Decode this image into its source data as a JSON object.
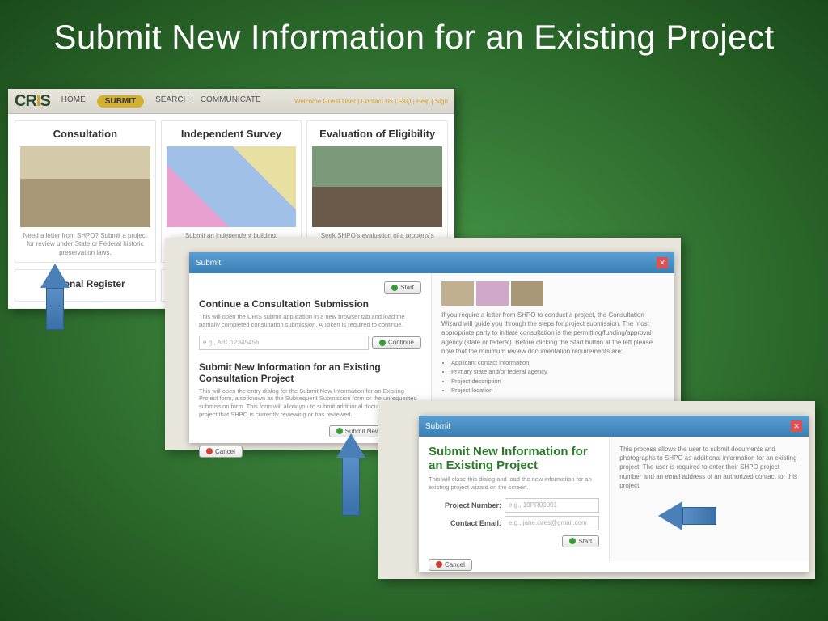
{
  "title": "Submit New Information for an Existing Project",
  "nav": {
    "logo": "CRIS",
    "items": [
      "HOME",
      "SUBMIT",
      "SEARCH",
      "COMMUNICATE"
    ],
    "welcome": "Welcome Guest User | Contact Us | FAQ | Help | Sign"
  },
  "cards": {
    "c1": {
      "title": "Consultation",
      "desc": "Need a letter from SHPO? Submit a project for review under State or Federal historic preservation laws."
    },
    "c2": {
      "title": "Independent Survey",
      "desc": "Submit an independent building,"
    },
    "c3": {
      "title": "Evaluation of Eligibility",
      "desc": "Seek SHPO's evaluation of a property's eligibility"
    },
    "c4": {
      "title": "National Register"
    }
  },
  "dialog1": {
    "bar": "Submit",
    "start": "Start",
    "sec1_title": "Continue a Consultation Submission",
    "sec1_desc": "This will open the CRIS submit application in a new browser tab and load the partially completed consultation submission. A Token is required to continue.",
    "sec1_placeholder": "e.g., ABC12345456",
    "sec1_btn": "Continue",
    "sec2_title": "Submit New Information for an Existing Consultation Project",
    "sec2_desc": "This will open the entry dialog for the Submit New Information for an Existing Project form, also known as the Subsequent Submission form or the unrequested submission form. This form will allow you to submit additional documentation for a project that SHPO is currently reviewing or has reviewed.",
    "sec2_btn": "Submit New Information",
    "cancel": "Cancel",
    "right_intro": "If you require a letter from SHPO to conduct a project, the Consultation Wizard will guide you through the steps for project submission. The most appropriate party to initiate consultation is the permitting/funding/approval agency (state or federal). Before clicking the Start button at the left please note that the minimum review documentation requirements are:",
    "right_bullets": [
      "Applicant contact information",
      "Primary state and/or federal agency",
      "Project description",
      "Project location"
    ]
  },
  "dialog2": {
    "bar": "Submit",
    "title": "Submit New Information for an Existing Project",
    "desc": "This will close this dialog and load the new information for an existing project wizard on the screen.",
    "field1": "Project Number:",
    "ph1": "e.g., 19PR00001",
    "field2": "Contact Email:",
    "ph2": "e.g., jane.cires@gmail.com",
    "start": "Start",
    "cancel": "Cancel",
    "right": "This process allows the user to submit documents and photographs to SHPO as additional information for an existing project. The user is required to enter their SHPO project number and an email address of an authorized contact for this project."
  }
}
